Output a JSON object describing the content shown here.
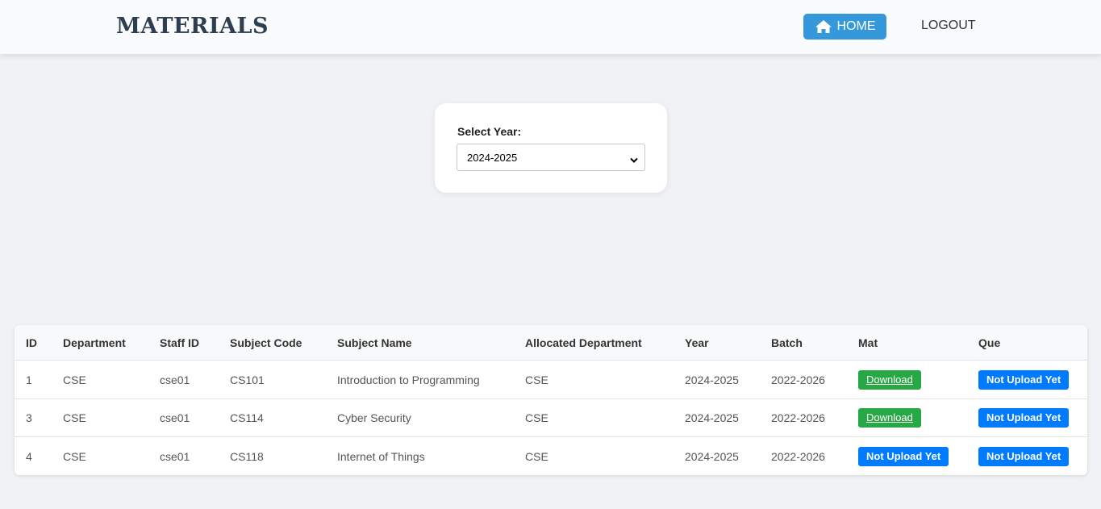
{
  "header": {
    "title": "MATERIALS",
    "home_label": "HOME",
    "logout_label": "LOGOUT",
    "home_icon": "home-icon",
    "accent": "#3498db"
  },
  "year_filter": {
    "label": "Select Year:",
    "selected": "2024-2025"
  },
  "table": {
    "columns": [
      "ID",
      "Department",
      "Staff ID",
      "Subject Code",
      "Subject Name",
      "Allocated Department",
      "Year",
      "Batch",
      "Mat",
      "Que"
    ],
    "rows": [
      {
        "id": "1",
        "department": "CSE",
        "staff_id": "cse01",
        "subject_code": "CS101",
        "subject_name": "Introduction to Programming",
        "allocated_department": "CSE",
        "year": "2024-2025",
        "batch": "2022-2026",
        "mat": "Download",
        "que": "Not Upload Yet"
      },
      {
        "id": "3",
        "department": "CSE",
        "staff_id": "cse01",
        "subject_code": "CS114",
        "subject_name": "Cyber Security",
        "allocated_department": "CSE",
        "year": "2024-2025",
        "batch": "2022-2026",
        "mat": "Download",
        "que": "Not Upload Yet"
      },
      {
        "id": "4",
        "department": "CSE",
        "staff_id": "cse01",
        "subject_code": "CS118",
        "subject_name": "Internet of Things",
        "allocated_department": "CSE",
        "year": "2024-2025",
        "batch": "2022-2026",
        "mat": "Not Upload Yet",
        "que": "Not Upload Yet"
      }
    ],
    "download_color": "#28a745",
    "not_uploaded_color": "#007bff"
  }
}
